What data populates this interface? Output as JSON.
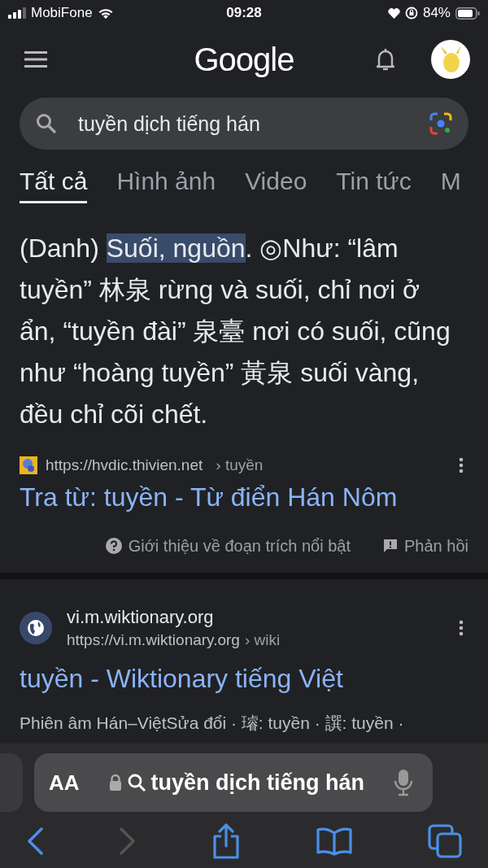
{
  "status_bar": {
    "carrier": "MobiFone",
    "time": "09:28",
    "battery": "84%"
  },
  "header": {
    "logo": "Google"
  },
  "search": {
    "value": "tuyền dịch tiếng hán"
  },
  "tabs": [
    {
      "label": "Tất cả",
      "selected": true
    },
    {
      "label": "Hình ảnh",
      "selected": false
    },
    {
      "label": "Video",
      "selected": false
    },
    {
      "label": "Tin tức",
      "selected": false
    },
    {
      "label": "M",
      "selected": false
    }
  ],
  "featured": {
    "snippet": [
      {
        "text": "(Danh) ",
        "highlighted": false
      },
      {
        "text": "Suối, nguồn",
        "highlighted": true
      },
      {
        "text": ". ◎Như: “lâm tuyền” 林泉 rừng và suối, chỉ nơi ở ẩn, “tuyền đài” 泉臺 nơi có suối, cũng như “hoàng tuyền” 黃泉 suối vàng, đều chỉ cõi chết.",
        "highlighted": false
      }
    ],
    "url": "https://hvdic.thivien.net",
    "path": "› tuyền",
    "title": "Tra từ: tuyền - Từ điển Hán Nôm",
    "about": "Giới thiệu về đoạn trích nổi bật",
    "feedback": "Phản hồi"
  },
  "result": {
    "site": "vi.m.wiktionary.org",
    "url": "https://vi.m.wiktionary.org",
    "path": "› wiki",
    "title": "tuyền - Wiktionary tiếng Việt",
    "snippet": "Phiên âm Hán–ViệtSửa đổi · 璿: tuyền · 譔: tuyền ·"
  },
  "browser_bar": {
    "text_size": "AA",
    "address": "tuyền dịch tiếng hán"
  }
}
